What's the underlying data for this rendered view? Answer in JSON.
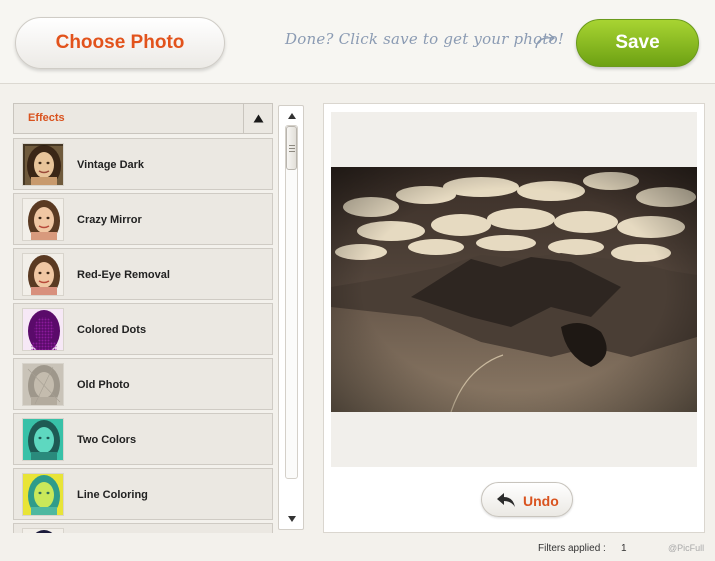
{
  "header": {
    "choose_photo_label": "Choose Photo",
    "hint_text": "Done? Click save to get your photo!",
    "save_label": "Save"
  },
  "effects": {
    "title": "Effects",
    "items": [
      {
        "label": "Vintage Dark",
        "thumb": "vintage-dark"
      },
      {
        "label": "Crazy Mirror",
        "thumb": "normal"
      },
      {
        "label": "Red-Eye Removal",
        "thumb": "normal"
      },
      {
        "label": "Colored Dots",
        "thumb": "colored-dots"
      },
      {
        "label": "Old Photo",
        "thumb": "old-photo"
      },
      {
        "label": "Two Colors",
        "thumb": "two-colors"
      },
      {
        "label": "Line Coloring",
        "thumb": "line-coloring"
      },
      {
        "label": "",
        "thumb": "partial"
      }
    ]
  },
  "preview": {
    "undo_label": "Undo"
  },
  "footer": {
    "filters_label": "Filters applied :",
    "filters_count": "1",
    "watermark": "@PicFull"
  },
  "colors": {
    "accent": "#d9531f",
    "save_green": "#7cb41c",
    "hint_blue": "#8b9bb3"
  }
}
